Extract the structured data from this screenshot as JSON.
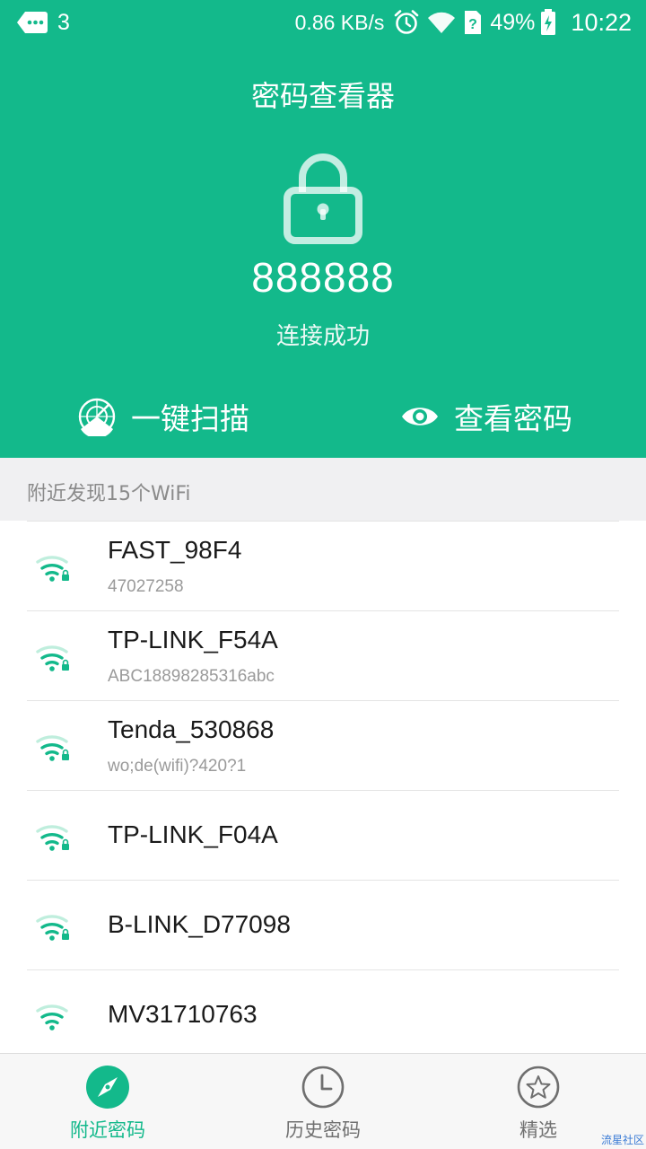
{
  "status_bar": {
    "notification_count": "3",
    "net_speed": "0.86 KB/s",
    "battery": "49%",
    "time": "10:22"
  },
  "header": {
    "title": "密码查看器",
    "password": "888888",
    "status": "连接成功",
    "scan_label": "一键扫描",
    "view_label": "查看密码"
  },
  "section": {
    "label": "附近发现15个WiFi"
  },
  "wifi_list": [
    {
      "ssid": "FAST_98F4",
      "password": "47027258",
      "locked": true
    },
    {
      "ssid": "TP-LINK_F54A",
      "password": "ABC18898285316abc",
      "locked": true
    },
    {
      "ssid": "Tenda_530868",
      "password": "wo;de(wifi)?420?1",
      "locked": true
    },
    {
      "ssid": "TP-LINK_F04A",
      "password": "",
      "locked": true
    },
    {
      "ssid": "B-LINK_D77098",
      "password": "",
      "locked": true
    },
    {
      "ssid": "MV31710763",
      "password": "",
      "locked": false
    }
  ],
  "tabs": [
    {
      "label": "附近密码",
      "icon": "compass-icon",
      "active": true
    },
    {
      "label": "历史密码",
      "icon": "clock-icon",
      "active": false
    },
    {
      "label": "精选",
      "icon": "star-icon",
      "active": false
    }
  ],
  "watermark": "流星社区",
  "colors": {
    "accent": "#13b98b",
    "wifi_faded": "#bfeedd"
  }
}
